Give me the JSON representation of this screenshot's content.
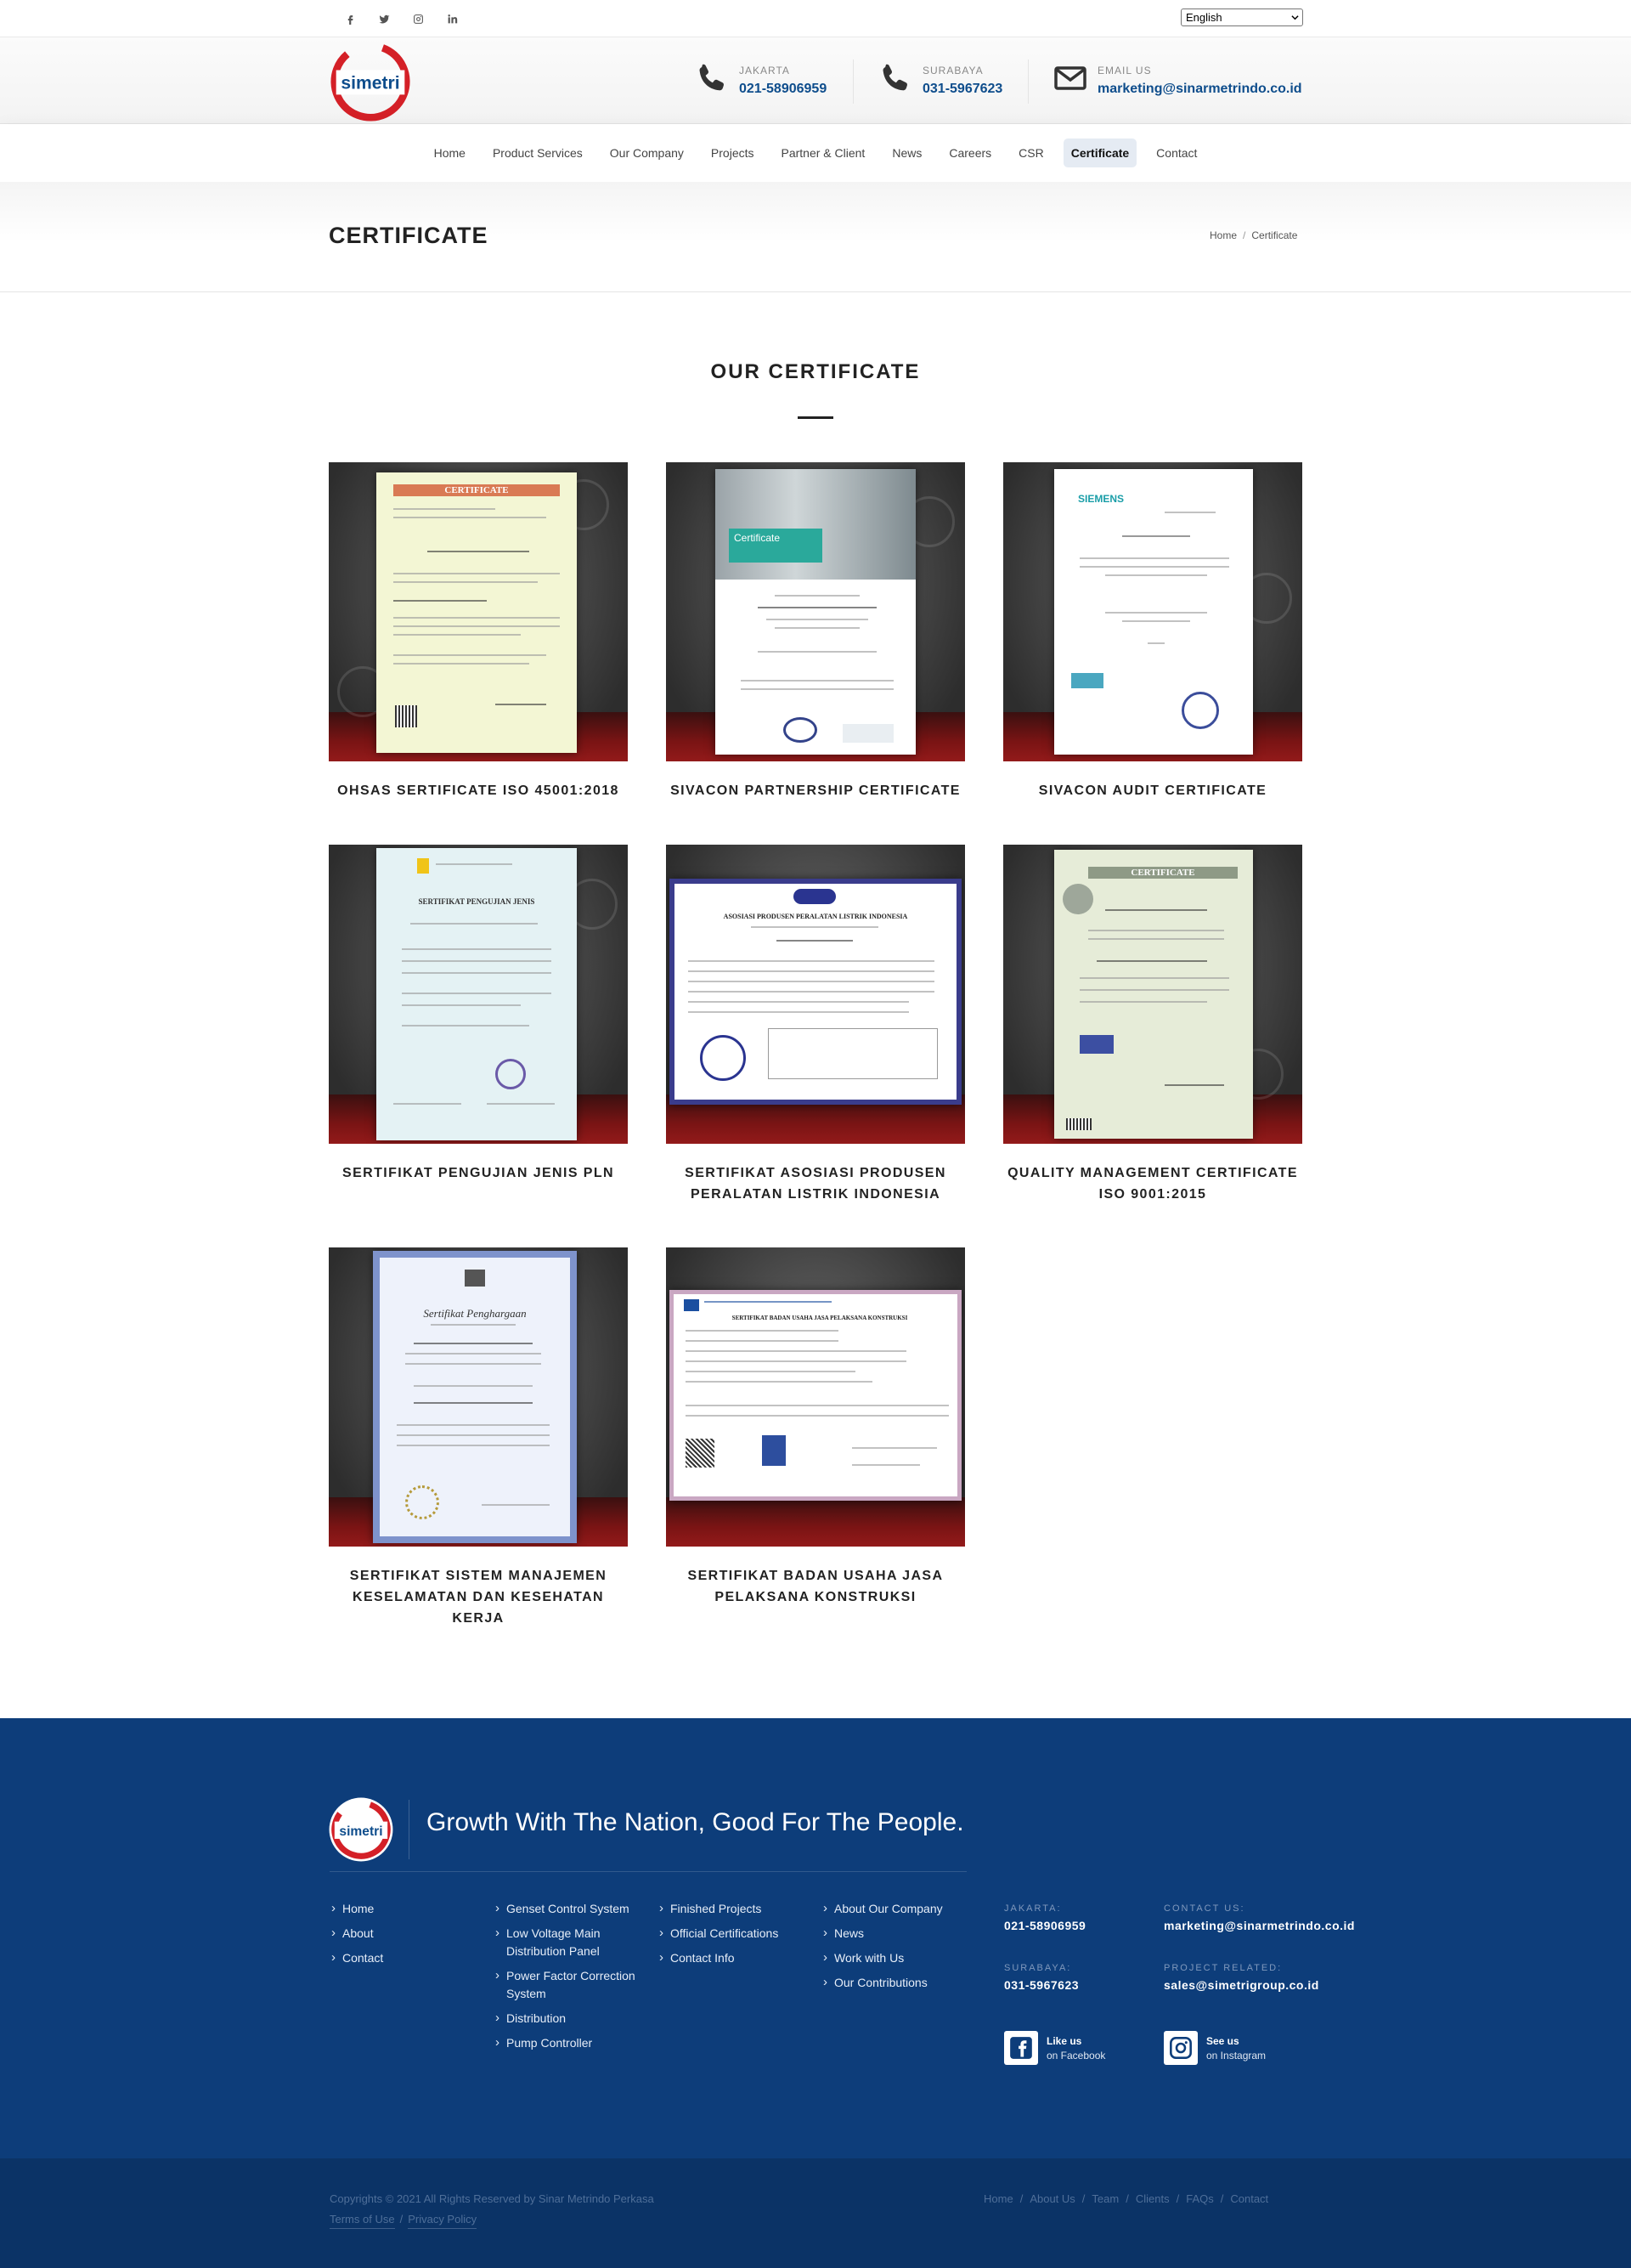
{
  "topbar": {
    "social": [
      {
        "icon": "facebook-icon"
      },
      {
        "icon": "twitter-icon"
      },
      {
        "icon": "instagram-icon"
      },
      {
        "icon": "linkedin-icon"
      }
    ],
    "language": "English"
  },
  "header": {
    "logo_text": "simetri",
    "contacts": [
      {
        "icon": "phone-icon",
        "label": "JAKARTA",
        "value": "021-58906959"
      },
      {
        "icon": "phone-icon",
        "label": "SURABAYA",
        "value": "031-5967623"
      },
      {
        "icon": "envelope-icon",
        "label": "EMAIL US",
        "value": "marketing@sinarmetrindo.co.id"
      }
    ]
  },
  "nav": {
    "items": [
      "Home",
      "Product Services",
      "Our Company",
      "Projects",
      "Partner & Client",
      "News",
      "Careers",
      "CSR",
      "Certificate",
      "Contact"
    ],
    "active": "Certificate"
  },
  "page_title": {
    "title": "CERTIFICATE",
    "breadcrumb": [
      "Home",
      "Certificate"
    ]
  },
  "section": {
    "heading": "OUR CERTIFICATE",
    "certificates": [
      {
        "title": "OHSAS SERTIFICATE ISO 45001:2018",
        "doc_header": "CERTIFICATE",
        "doc_kind": "iso-yellow"
      },
      {
        "title": "SIVACON PARTNERSHIP CERTIFICATE",
        "doc_header": "Certificate",
        "doc_kind": "siemens-partner"
      },
      {
        "title": "SIVACON AUDIT CERTIFICATE",
        "doc_header": "SIEMENS",
        "doc_kind": "siemens-audit"
      },
      {
        "title": "SERTIFIKAT PENGUJIAN JENIS PLN",
        "doc_header": "SERTIFIKAT PENGUJIAN JENIS",
        "doc_kind": "pln"
      },
      {
        "title": "SERTIFIKAT ASOSIASI PRODUSEN PERALATAN LISTRIK INDONESIA",
        "doc_header": "ASOSIASI PRODUSEN PERALATAN LISTRIK INDONESIA",
        "doc_kind": "appi"
      },
      {
        "title": "QUALITY MANAGEMENT CERTIFICATE ISO 9001:2015",
        "doc_header": "CERTIFICATE",
        "doc_kind": "iso-green"
      },
      {
        "title": "SERTIFIKAT SISTEM MANAJEMEN KESELAMATAN DAN KESEHATAN KERJA",
        "doc_header": "Sertifikat Penghargaan",
        "doc_kind": "smk3"
      },
      {
        "title": "SERTIFIKAT BADAN USAHA JASA PELAKSANA KONSTRUKSI",
        "doc_header": "SERTIFIKAT BADAN USAHA JASA PELAKSANA KONSTRUKSI",
        "doc_kind": "lpjk"
      }
    ]
  },
  "footer": {
    "slogan": "Growth With The Nation, Good For The People.",
    "columns": [
      [
        "Home",
        "About",
        "Contact"
      ],
      [
        "Genset Control System",
        "Low Voltage Main Distribution Panel",
        "Power Factor Correction System",
        "Distribution",
        "Pump Controller"
      ],
      [
        "Finished Projects",
        "Official Certifications",
        "Contact Info"
      ],
      [
        "About Our Company",
        "News",
        "Work with Us",
        "Our Contributions"
      ]
    ],
    "info": [
      {
        "label": "JAKARTA:",
        "value": "021-58906959"
      },
      {
        "label": "CONTACT US:",
        "value": "marketing@sinarmetrindo.co.id"
      },
      {
        "label": "SURABAYA:",
        "value": "031-5967623"
      },
      {
        "label": "PROJECT RELATED:",
        "value": "sales@simetrigroup.co.id"
      }
    ],
    "social": [
      {
        "icon": "facebook-icon",
        "line1": "Like us",
        "line2": "on Facebook"
      },
      {
        "icon": "instagram-icon",
        "line1": "See us",
        "line2": "on Instagram"
      }
    ],
    "copyright": "Copyrights © 2021 All Rights Reserved by Sinar Metrindo Perkasa",
    "legal": [
      "Terms of Use",
      "Privacy Policy"
    ],
    "nav": [
      "Home",
      "About Us",
      "Team",
      "Clients",
      "FAQs",
      "Contact"
    ]
  },
  "colors": {
    "brand_red": "#d42027",
    "brand_blue": "#0e4d8c",
    "footer_bg": "#0d3d7a"
  }
}
